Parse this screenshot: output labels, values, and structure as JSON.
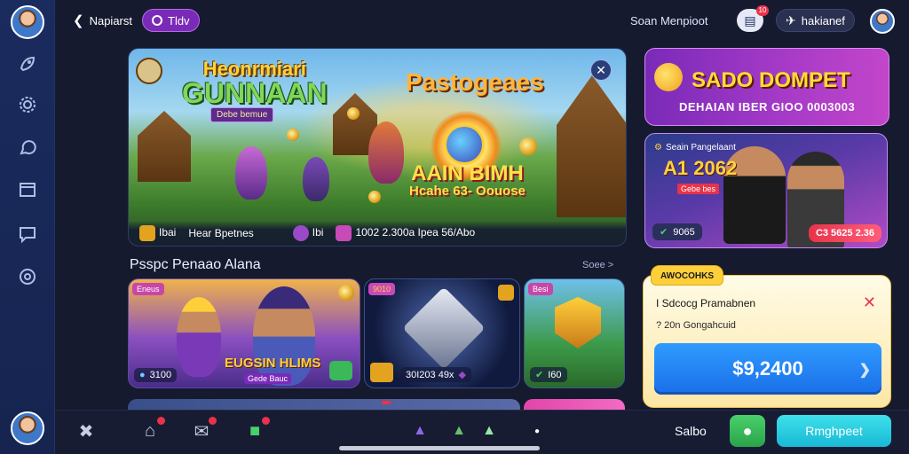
{
  "header": {
    "nav_label": "Napiarst",
    "mode_pill": "Tldv",
    "center_text": "Soan  Menpioot",
    "notification_count": "10",
    "account_label": "hakianef"
  },
  "sidebar": {
    "items": [
      {
        "icon": "rocket-icon"
      },
      {
        "icon": "settings-icon"
      },
      {
        "icon": "chat-icon"
      },
      {
        "icon": "window-icon"
      },
      {
        "icon": "message-icon"
      },
      {
        "icon": "support-icon"
      }
    ]
  },
  "hero": {
    "title_line1": "Heonrmiari",
    "title_line2": "GUNNAAN",
    "subtitle": "Debe bemue",
    "promo_title": "Pastogeaes",
    "win_line1": "AAIN BIMH",
    "win_line2": "Hcahe 63- Oouose",
    "footer": {
      "item1": "Ibai",
      "item2": "Hear Bpetnes",
      "item3": "Ibi",
      "item4": "1002  2.300a  Ipea  56/Abo"
    }
  },
  "promo_top": {
    "title": "SADO DOMPET",
    "subtitle": "DEHAIAN IBER GIOO 0003003"
  },
  "promo_side": {
    "header": "Seain Pangelaant",
    "amount": "A1 2062",
    "tag": "Gebe bes",
    "chip": "9065",
    "cta": "C3 5625 2.36"
  },
  "section": {
    "title": "Psspc Penaao Alana",
    "link": "Soee >"
  },
  "games": [
    {
      "tag": "Eneus",
      "foot": "3100",
      "title": "EUGSIN HLIMS",
      "sub": "Gede Bauc"
    },
    {
      "tag": "9010",
      "foot": "30I203 49x"
    },
    {
      "tag": "Besi",
      "foot": "I60"
    }
  ],
  "wallet": {
    "tab": "AWOCOHKS",
    "line1": "I Sdcocg Pramabnen",
    "line2": "? 20n Gongahcuid",
    "amount": "$9,2400"
  },
  "bottom": {
    "saldo": "Salbo",
    "primary": "Rmghpeet"
  },
  "colors": {
    "accent_purple": "#7a2ab8",
    "accent_cyan": "#1ab8d6",
    "accent_blue": "#1a6fe8",
    "badge_red": "#e8334a"
  }
}
